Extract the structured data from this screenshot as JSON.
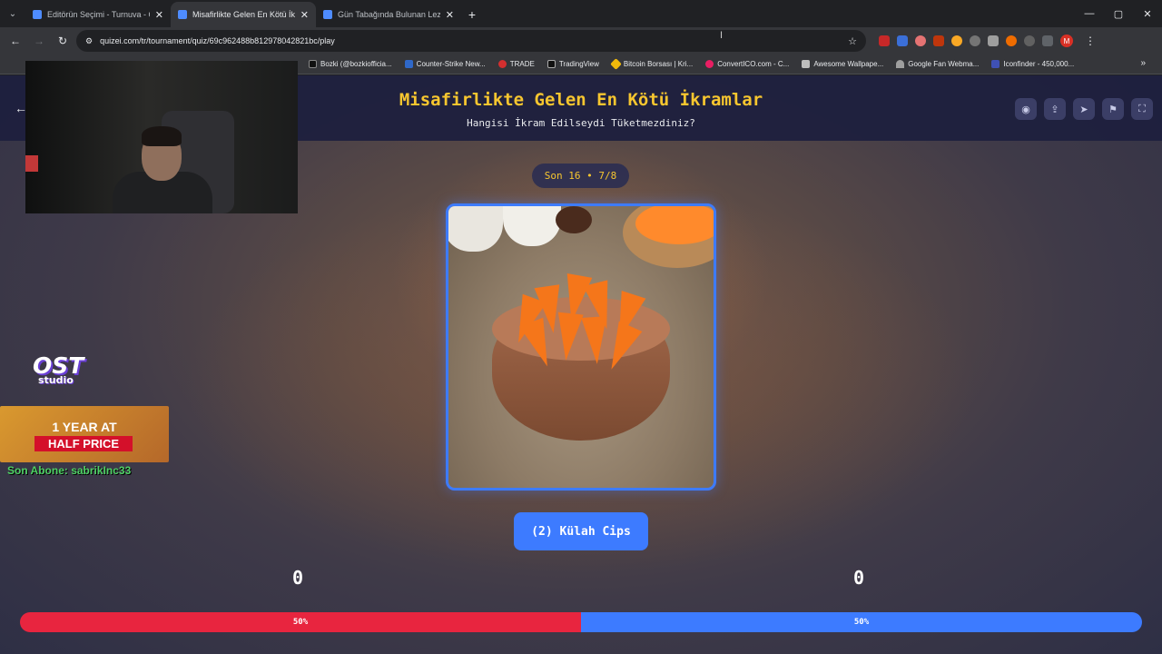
{
  "browser": {
    "tabs": [
      {
        "title": "Editörün Seçimi - Turnuva - Qu",
        "active": false
      },
      {
        "title": "Misafirlikte Gelen En Kötü İkram",
        "active": true
      },
      {
        "title": "Gün Tabağında Bulunan Lezzet",
        "active": false
      }
    ],
    "url": "quizei.com/tr/tournament/quiz/69c962488b812978042821bc/play",
    "bookmarks": [
      "Bozki (@bozkiofficia...",
      "Counter-Strike New...",
      "TRADE",
      "TradingView",
      "Bitcoin Borsası | Kri...",
      "ConvertICO.com - C...",
      "Awesome Wallpape...",
      "Google Fan Webma...",
      "Iconfinder - 450,000..."
    ],
    "profile_initial": "M"
  },
  "quiz": {
    "title": "Misafirlikte Gelen En Kötü İkramlar",
    "subtitle": "Hangisi İkram Edilseydi Tüketmezdiniz?",
    "round": "Son 16 • 7/8",
    "choice_label": "(2) Külah Cips",
    "score_left": "0",
    "score_right": "0",
    "vote_left_pct": 50,
    "vote_right_pct": 50,
    "vote_left_label": "50%",
    "vote_right_label": "50%",
    "colors": {
      "left": "#e8253f",
      "right": "#3d7bff",
      "title": "#f7c62f"
    }
  },
  "overlay": {
    "logo_big": "OST",
    "logo_small": "studio",
    "promo_line1": "1 YEAR AT",
    "promo_line2": "HALF PRICE",
    "last_sub": "Son Abone: sabrikInc33"
  }
}
